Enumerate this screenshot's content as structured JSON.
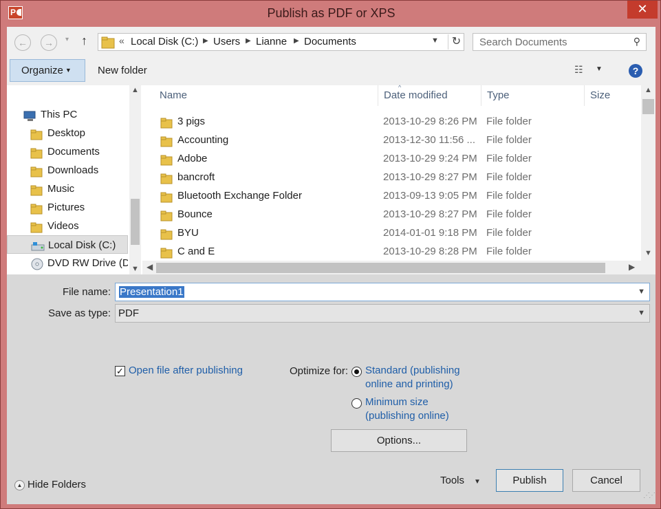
{
  "window": {
    "title": "Publish as PDF or XPS",
    "app_icon_letter": "P",
    "close_glyph": "✕"
  },
  "nav": {
    "back_glyph": "←",
    "forward_glyph": "→",
    "recent_glyph": "▾",
    "up_glyph": "↑",
    "breadcrumb_overflow": "«",
    "breadcrumb": [
      "Local Disk (C:)",
      "Users",
      "Lianne",
      "Documents"
    ],
    "search_placeholder": "Search Documents",
    "search_glyph": "⚲",
    "refresh_glyph": "↻"
  },
  "toolbar": {
    "organize_label": "Organize",
    "new_folder_label": "New folder",
    "help_glyph": "?",
    "view_glyph": "☷"
  },
  "sidebar": {
    "items": [
      {
        "label": "This PC",
        "icon": "computer-icon"
      },
      {
        "label": "Desktop",
        "icon": "folder-icon"
      },
      {
        "label": "Documents",
        "icon": "folder-icon"
      },
      {
        "label": "Downloads",
        "icon": "folder-icon"
      },
      {
        "label": "Music",
        "icon": "folder-icon"
      },
      {
        "label": "Pictures",
        "icon": "folder-icon"
      },
      {
        "label": "Videos",
        "icon": "folder-icon"
      },
      {
        "label": "Local Disk (C:)",
        "icon": "drive-icon",
        "selected": true
      },
      {
        "label": "DVD RW Drive (D",
        "icon": "dvd-icon"
      }
    ]
  },
  "files": {
    "columns": [
      "Name",
      "Date modified",
      "Type",
      "Size"
    ],
    "rows": [
      {
        "name": "3 pigs",
        "date": "2013-10-29 8:26 PM",
        "type": "File folder"
      },
      {
        "name": "Accounting",
        "date": "2013-12-30 11:56 ...",
        "type": "File folder"
      },
      {
        "name": "Adobe",
        "date": "2013-10-29 9:24 PM",
        "type": "File folder"
      },
      {
        "name": "bancroft",
        "date": "2013-10-29 8:27 PM",
        "type": "File folder"
      },
      {
        "name": "Bluetooth Exchange Folder",
        "date": "2013-09-13 9:05 PM",
        "type": "File folder"
      },
      {
        "name": "Bounce",
        "date": "2013-10-29 8:27 PM",
        "type": "File folder"
      },
      {
        "name": "BYU",
        "date": "2014-01-01 9:18 PM",
        "type": "File folder"
      },
      {
        "name": "C and E",
        "date": "2013-10-29 8:28 PM",
        "type": "File folder"
      }
    ]
  },
  "form": {
    "file_name_label": "File name:",
    "file_name_value": "Presentation1",
    "save_type_label": "Save as type:",
    "save_type_value": "PDF",
    "open_after_label": "Open file after publishing",
    "open_after_checked": true,
    "optimize_label": "Optimize for:",
    "opt_standard_line1": "Standard (publishing",
    "opt_standard_line2": "online and printing)",
    "opt_min_line1": "Minimum size",
    "opt_min_line2": "(publishing online)",
    "options_label": "Options..."
  },
  "footer": {
    "hide_folders_label": "Hide Folders",
    "tools_label": "Tools",
    "publish_label": "Publish",
    "cancel_label": "Cancel"
  },
  "colors": {
    "frame": "#cf7b7b",
    "accent_blue": "#1f5ea8",
    "selection": "#3a78c8",
    "folder_yellow": "#e8c14a"
  }
}
